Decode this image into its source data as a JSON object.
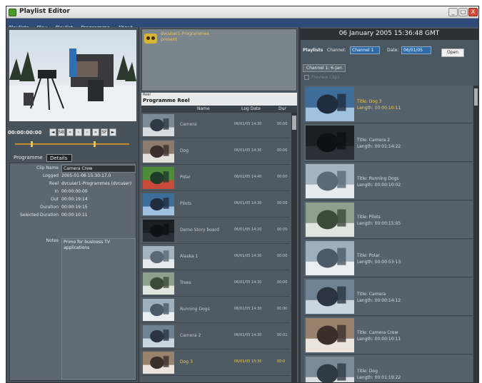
{
  "window": {
    "title": "Playlist Editor",
    "min": "_",
    "max": "□",
    "close": "X"
  },
  "menu": [
    "Playlists",
    "Play",
    "Playlist",
    "Programme",
    "About"
  ],
  "transport": {
    "timecode": "00:00:00:00",
    "buttons": [
      "◄",
      "SB",
      "«",
      "‹",
      "›",
      "»",
      "SF",
      "►"
    ]
  },
  "left_tabs": {
    "programme": "Programme",
    "details": "Details"
  },
  "details": {
    "fields": [
      {
        "key": "Clip Name",
        "value": "Camera Crew",
        "field": true
      },
      {
        "key": "Logged",
        "value": "2005-01-06 15:30:17.0",
        "field": false
      },
      {
        "key": "Reel",
        "value": "dvcuser1-Programmes (dvcuser)",
        "field": false
      },
      {
        "key": "In",
        "value": "00:00:00:00",
        "field": false
      },
      {
        "key": "Out",
        "value": "00:00:19:14",
        "field": false
      },
      {
        "key": "Duration",
        "value": "00:00:19:15",
        "field": false
      },
      {
        "key": "Selected Duration",
        "value": "00:00:10:11",
        "field": false
      }
    ],
    "notes_label": "Notes",
    "notes": "Primo for business TV applications"
  },
  "programme_header": {
    "line1": "dvcuser1-Programmes",
    "line2": "present"
  },
  "reel": {
    "small_label": "Reel",
    "title": "Programme Reel",
    "columns": {
      "name": "Name",
      "log_date": "Log Date",
      "dur": "Dur"
    },
    "rows": [
      {
        "name": "Camera",
        "date": "06/01/05 14:30",
        "dur": "00:00",
        "selected": false
      },
      {
        "name": "Dog",
        "date": "06/01/05 14:30",
        "dur": "00:00",
        "selected": false
      },
      {
        "name": "Polar",
        "date": "06/01/05 14:40",
        "dur": "00:00",
        "selected": false
      },
      {
        "name": "Pilots",
        "date": "06/01/05 14:30",
        "dur": "00:00",
        "selected": false
      },
      {
        "name": "Demo Story board",
        "date": "06/01/05 14:20",
        "dur": "00:00",
        "selected": false
      },
      {
        "name": "Alaska 1",
        "date": "06/01/05 14:30",
        "dur": "00:00",
        "selected": false
      },
      {
        "name": "Trees",
        "date": "06/01/05 14:30",
        "dur": "00:00",
        "selected": false
      },
      {
        "name": "Running Dogs",
        "date": "06/01/05 14:30",
        "dur": "00:00",
        "selected": false
      },
      {
        "name": "Camera 2",
        "date": "06/01/05 14:30",
        "dur": "00:01",
        "selected": false
      },
      {
        "name": "Dog 3",
        "date": "06/01/05 15:30",
        "dur": "00:0",
        "selected": true
      }
    ]
  },
  "right": {
    "datetime": "06 January 2005 15:36:48 GMT",
    "playlists_label": "Playlists",
    "channel_label": "Channel:",
    "channel_value": "Channel 1",
    "date_label": "Date:",
    "date_value": "06/01/05",
    "open_button": "Open",
    "channel_tab": "Channel 1: 6-Jan",
    "checkbox_label": "Preview Clips",
    "clips": [
      {
        "title": "Title: Dog 3",
        "length": "Length: 00:00:10:11",
        "selected": true
      },
      {
        "title": "Title: Camera 2",
        "length": "Length: 00:01:14:22",
        "selected": false
      },
      {
        "title": "Title: Running Dogs",
        "length": "Length: 00:00:10:02",
        "selected": false
      },
      {
        "title": "Title: Pilots",
        "length": "Length: 00:00:15:05",
        "selected": false
      },
      {
        "title": "Title: Polar",
        "length": "Length: 00:00:53:13",
        "selected": false
      },
      {
        "title": "Title: Camera",
        "length": "Length: 00:00:14:12",
        "selected": false
      },
      {
        "title": "Title: Camera Crew",
        "length": "Length: 00:00:10:11",
        "selected": false
      },
      {
        "title": "Title: Dog",
        "length": "Length: 00:01:19:22",
        "selected": false
      }
    ]
  }
}
